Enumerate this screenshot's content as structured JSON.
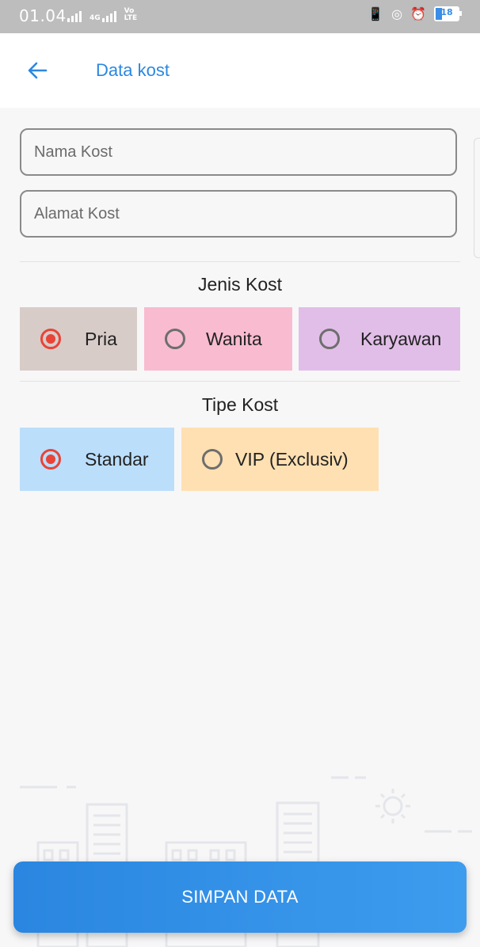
{
  "status_bar": {
    "time": "01.04",
    "network_label": "4G",
    "volte_label": "Vo LTE",
    "battery_level": "18",
    "icons": [
      "signal-icon",
      "volte-icon",
      "vibrate-icon",
      "data-saver-icon",
      "alarm-icon",
      "battery-icon"
    ]
  },
  "app_bar": {
    "back_icon": "arrow-left-icon",
    "title": "Data kost",
    "accent_color": "#2b88e0"
  },
  "form": {
    "nama_placeholder": "Nama Kost",
    "alamat_placeholder": "Alamat Kost",
    "nama_value": "",
    "alamat_value": ""
  },
  "jenis_kost": {
    "title": "Jenis Kost",
    "options": [
      {
        "label": "Pria",
        "selected": true,
        "color": "#d7ccc8"
      },
      {
        "label": "Wanita",
        "selected": false,
        "color": "#f8bbd0"
      },
      {
        "label": "Karyawan",
        "selected": false,
        "color": "#e1bee7"
      }
    ]
  },
  "tipe_kost": {
    "title": "Tipe Kost",
    "options": [
      {
        "label": "Standar",
        "selected": true,
        "color": "#bbdefb"
      },
      {
        "label": "VIP (Exclusiv)",
        "selected": false,
        "color": "#ffe0b2"
      }
    ]
  },
  "radio_selected_color": "#e84437",
  "save_button": {
    "label": "SIMPAN DATA",
    "color": "#2a86e0"
  }
}
